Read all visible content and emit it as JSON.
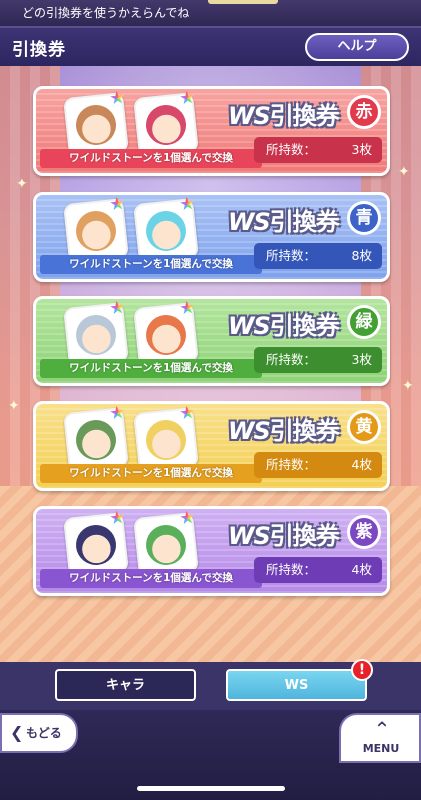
{
  "instruction": "どの引換券を使うかえらんでね",
  "header": {
    "title": "引換券",
    "help_label": "ヘルプ"
  },
  "ribbon_text": "ワイルドストーンを1個選んで交換",
  "count_label": "所持数：",
  "title_ws": "WS",
  "title_ticket": "引換券",
  "tickets": [
    {
      "color_name": "赤",
      "count": "3枚",
      "card_color": "#f07a78",
      "card_light": "#f7a3a0",
      "ribbon_color": "#e8455a",
      "badge_color": "#e03a4c",
      "bar_color": "#c8324a",
      "faces": [
        "#c9885a",
        "#d8486a"
      ]
    },
    {
      "color_name": "青",
      "count": "8枚",
      "card_color": "#7fa2ec",
      "card_light": "#a9c2f5",
      "ribbon_color": "#4a73d8",
      "badge_color": "#3d63c8",
      "bar_color": "#3456b8",
      "faces": [
        "#e0a060",
        "#6bd3e6"
      ]
    },
    {
      "color_name": "緑",
      "count": "3枚",
      "card_color": "#8ed276",
      "card_light": "#b3e59e",
      "ribbon_color": "#4fae3e",
      "badge_color": "#44a034",
      "bar_color": "#3c8e2e",
      "faces": [
        "#b8c8d8",
        "#e8784a"
      ]
    },
    {
      "color_name": "黄",
      "count": "4枚",
      "card_color": "#f4cf52",
      "card_light": "#f8e08c",
      "ribbon_color": "#e6a020",
      "badge_color": "#e39a18",
      "bar_color": "#d48a10",
      "faces": [
        "#6a9a5a",
        "#f0d060"
      ]
    },
    {
      "color_name": "紫",
      "count": "4枚",
      "card_color": "#b58ae8",
      "card_light": "#cfb0f2",
      "ribbon_color": "#8a55d0",
      "badge_color": "#7c48c2",
      "bar_color": "#6e3cb4",
      "faces": [
        "#3a3670",
        "#5ab05a"
      ]
    }
  ],
  "tabs": {
    "chara_label": "キャラ",
    "ws_label": "WS",
    "alert": "!"
  },
  "footer": {
    "back_label": "もどる",
    "menu_label": "MENU"
  },
  "icons": {
    "back": "chevron-left-icon",
    "menu": "chevron-up-icon",
    "alert": "exclamation-icon",
    "star": "rainbow-star-icon"
  }
}
